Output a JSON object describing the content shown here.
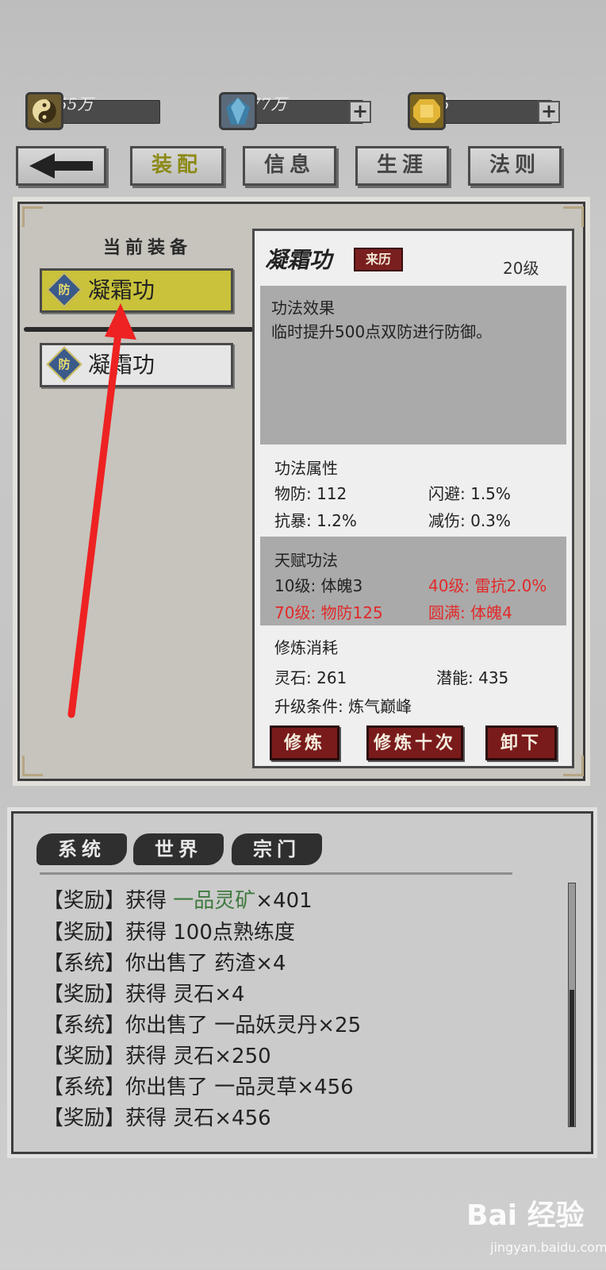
{
  "currency": [
    {
      "icon": "yin-yang-icon",
      "value": "55万",
      "has_plus": false
    },
    {
      "icon": "blue-crystal-icon",
      "value": "77万",
      "has_plus": true
    },
    {
      "icon": "gold-gem-icon",
      "value": "5",
      "has_plus": true
    }
  ],
  "nav": {
    "back_icon": "arrow-left-icon",
    "tabs": [
      "装配",
      "信息",
      "生涯",
      "法则"
    ],
    "active_tab": "装配"
  },
  "equip_panel": {
    "title": "当前装备",
    "items": [
      {
        "badge": "防",
        "name": "凝霜功",
        "selected": true
      },
      {
        "badge": "防",
        "name": "凝霜功",
        "selected": false
      }
    ]
  },
  "detail": {
    "name": "凝霜功",
    "origin_label": "来历",
    "level": "20级",
    "effect_heading": "功法效果",
    "effect_text": "临时提升500点双防进行防御。",
    "attr_heading": "功法属性",
    "attrs": [
      {
        "text": "物防: 112"
      },
      {
        "text": "闪避: 1.5%"
      },
      {
        "text": "抗暴: 1.2%"
      },
      {
        "text": "减伤: 0.3%"
      }
    ],
    "talent_heading": "天赋功法",
    "talents": [
      {
        "text": "10级: 体魄3",
        "highlight": false
      },
      {
        "text": "40级: 雷抗2.0%",
        "highlight": true
      },
      {
        "text": "70级: 物防125",
        "highlight": true
      },
      {
        "text": "圆满: 体魄4",
        "highlight": true
      }
    ],
    "cost_heading": "修炼消耗",
    "cost_stone": "灵石: 261",
    "cost_potential": "潜能: 435",
    "upgrade_cond": "升级条件: 炼气巅峰",
    "buttons": [
      "修炼",
      "修炼十次",
      "卸下"
    ]
  },
  "chat": {
    "tabs": [
      "系统",
      "世界",
      "宗门"
    ],
    "lines": [
      {
        "prefix": "【奖励】获得 ",
        "highlight": "一品灵矿",
        "suffix": "×401"
      },
      {
        "prefix": "【奖励】获得 100点熟练度",
        "highlight": "",
        "suffix": ""
      },
      {
        "prefix": "【系统】你出售了 药渣×4",
        "highlight": "",
        "suffix": ""
      },
      {
        "prefix": "【奖励】获得 灵石×4",
        "highlight": "",
        "suffix": ""
      },
      {
        "prefix": "【系统】你出售了 一品妖灵丹×25",
        "highlight": "",
        "suffix": ""
      },
      {
        "prefix": "【奖励】获得 灵石×250",
        "highlight": "",
        "suffix": ""
      },
      {
        "prefix": "【系统】你出售了 一品灵草×456",
        "highlight": "",
        "suffix": ""
      },
      {
        "prefix": "【奖励】获得 灵石×456",
        "highlight": "",
        "suffix": ""
      }
    ]
  },
  "watermark": {
    "brand": "Bai 经验",
    "url": "jingyan.baidu.com"
  },
  "colors": {
    "accent_yellow": "#c9c23a",
    "button_red": "#7a1b1b",
    "talent_red": "#e12a2a",
    "chat_green": "#3f7a3f",
    "annotation_arrow": "#ee2222"
  }
}
